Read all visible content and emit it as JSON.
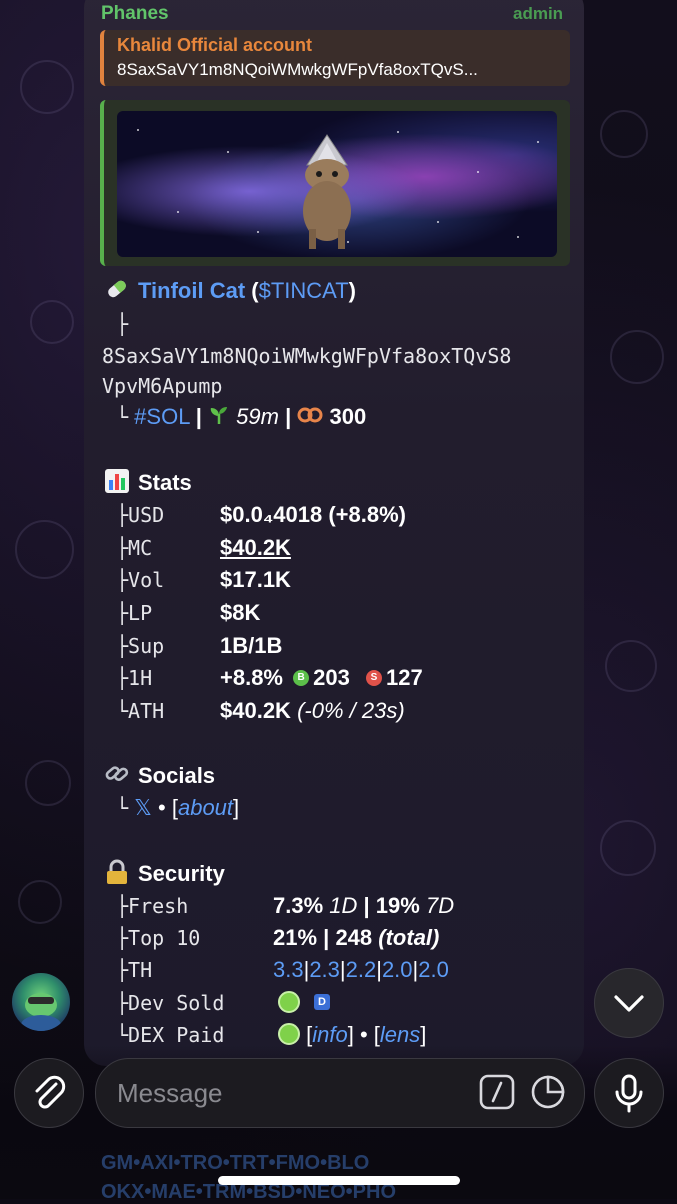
{
  "message": {
    "sender": "Phanes",
    "role": "admin",
    "reply": {
      "title": "Khalid Official account",
      "text": "8SaxSaVY1m8NQoiWMwkgWFpVfa8oxTQvS..."
    },
    "token": {
      "name": "Tinfoil Cat",
      "ticker": "$TINCAT",
      "address_line1": "8SaxSaVY1m8NQoiWMwkgWFpVfa8oxTQvS8",
      "address_line2": "VpvM6Apump",
      "chain": "#SOL",
      "age": "59m",
      "count": "300"
    },
    "stats": {
      "heading": "Stats",
      "rows": [
        {
          "label": "USD",
          "value": "$0.0₄4018 (+8.8%)"
        },
        {
          "label": "MC",
          "value": "$40.2K"
        },
        {
          "label": "Vol",
          "value": "$17.1K"
        },
        {
          "label": "LP",
          "value": "$8K"
        },
        {
          "label": "Sup",
          "value": "1B/1B"
        },
        {
          "label": "1H",
          "value": "+8.8%",
          "buys": "203",
          "sells": "127"
        },
        {
          "label": "ATH",
          "value": "$40.2K",
          "detail": "(-0% / 23s)"
        }
      ]
    },
    "socials": {
      "heading": "Socials",
      "x_icon": "𝕏",
      "link": "about"
    },
    "security": {
      "heading": "Security",
      "fresh": {
        "label": "Fresh",
        "v1": "7.3%",
        "p1": "1D",
        "v2": "19%",
        "p2": "7D"
      },
      "top10": {
        "label": "Top 10",
        "v1": "21%",
        "v2": "248",
        "note": "(total)"
      },
      "th": {
        "label": "TH",
        "values": [
          "3.3",
          "2.3",
          "2.2",
          "2.0",
          "2.0"
        ]
      },
      "dev_sold": {
        "label": "Dev Sold"
      },
      "dex_paid": {
        "label": "DEX Paid",
        "link1": "info",
        "link2": "lens"
      }
    }
  },
  "composer": {
    "placeholder": "Message"
  },
  "faded_lines": {
    "line1": "GM•AXI•TRO•TRT•FMO•BLO",
    "line2": "OKX•MAE•TRM•BSD•NEO•PHO"
  },
  "colors": {
    "accent_green": "#61c46a",
    "reply_orange": "#e8873c",
    "link_blue": "#5d9cf5"
  }
}
